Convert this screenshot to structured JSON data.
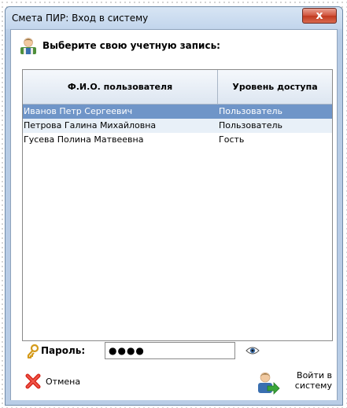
{
  "window": {
    "title": "Смета ПИР: Вход в систему",
    "close_label": "x"
  },
  "header": {
    "text": "Выберите свою учетную запись:"
  },
  "table": {
    "columns": [
      "Ф.И.О. пользователя",
      "Уровень доступа"
    ],
    "rows": [
      {
        "name": "Иванов Петр Сергеевич",
        "access": "Пользователь",
        "selected": true
      },
      {
        "name": "Петрова Галина Михайловна",
        "access": "Пользователь",
        "selected": false
      },
      {
        "name": "Гусева Полина Матвеевна",
        "access": "Гость",
        "selected": false
      }
    ]
  },
  "password": {
    "label": "Пароль:",
    "value": "●●●●"
  },
  "buttons": {
    "cancel_label": "Отмена",
    "login_label": "Войти в\nсистему"
  },
  "colors": {
    "selected_row": "#6f95c8",
    "alt_row": "#e8f0f8",
    "close_button": "#d0533c"
  },
  "icons": {
    "user": "user-account-icon",
    "key": "key-icon",
    "eye": "eye-icon",
    "cancel": "red-x-icon",
    "login": "user-arrow-login-icon"
  }
}
